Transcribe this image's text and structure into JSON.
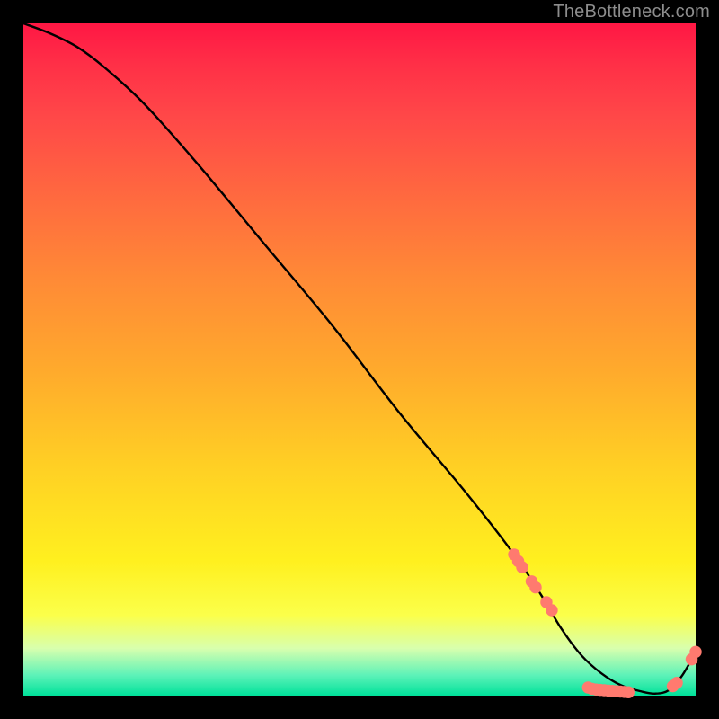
{
  "attribution": "TheBottleneck.com",
  "colors": {
    "page_bg": "#000000",
    "attribution_text": "#8d8d8d",
    "line": "#000000",
    "dot": "#ff7a6f"
  },
  "chart_data": {
    "type": "line",
    "title": "",
    "xlabel": "",
    "ylabel": "",
    "xlim": [
      0,
      100
    ],
    "ylim": [
      0,
      100
    ],
    "grid": false,
    "series": [
      {
        "name": "bottleneck-curve",
        "x": [
          0,
          4,
          8,
          12,
          18,
          26,
          36,
          46,
          56,
          66,
          73,
          77,
          80,
          83,
          86,
          89,
          92,
          94,
          96,
          98,
          100
        ],
        "y": [
          100,
          98.5,
          96.5,
          93.5,
          88,
          79,
          67,
          55,
          42,
          30,
          21,
          15,
          10,
          6,
          3.3,
          1.5,
          0.6,
          0.3,
          0.8,
          3,
          6.5
        ]
      }
    ],
    "points": [
      {
        "x": 73.0,
        "y": 21.0
      },
      {
        "x": 73.6,
        "y": 20.0
      },
      {
        "x": 74.2,
        "y": 19.1
      },
      {
        "x": 75.6,
        "y": 17.0
      },
      {
        "x": 76.2,
        "y": 16.1
      },
      {
        "x": 77.8,
        "y": 13.9
      },
      {
        "x": 78.6,
        "y": 12.7
      },
      {
        "x": 84.0,
        "y": 1.2
      },
      {
        "x": 84.6,
        "y": 1.0
      },
      {
        "x": 85.2,
        "y": 0.9
      },
      {
        "x": 85.8,
        "y": 0.85
      },
      {
        "x": 86.4,
        "y": 0.8
      },
      {
        "x": 87.0,
        "y": 0.75
      },
      {
        "x": 87.6,
        "y": 0.7
      },
      {
        "x": 88.2,
        "y": 0.65
      },
      {
        "x": 88.8,
        "y": 0.6
      },
      {
        "x": 89.4,
        "y": 0.55
      },
      {
        "x": 90.0,
        "y": 0.5
      },
      {
        "x": 96.6,
        "y": 1.4
      },
      {
        "x": 97.2,
        "y": 1.9
      },
      {
        "x": 99.4,
        "y": 5.4
      },
      {
        "x": 100.0,
        "y": 6.5
      }
    ]
  }
}
